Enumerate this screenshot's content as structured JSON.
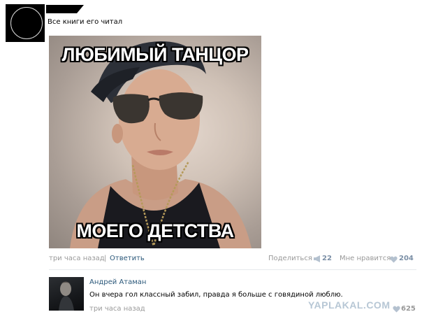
{
  "post": {
    "text": "Все книги его читал",
    "meme": {
      "caption_top": "ЛЮБИМЫЙ ТАНЦОР",
      "caption_bottom": "МОЕГО ДЕТСТВА"
    },
    "time": "три часа назад",
    "separator": "|",
    "reply_label": "Ответить",
    "share_label": "Поделиться",
    "share_icon": "megaphone-icon",
    "share_count": "22",
    "like_label": "Мне нравится",
    "like_icon": "heart-icon",
    "like_count": "204"
  },
  "comment": {
    "author": "Андрей Атаман",
    "text": "Он вчера гол классный забил, правда я больше с говядиной люблю.",
    "time": "три часа назад",
    "like_icon": "heart-icon",
    "like_count": "625"
  },
  "watermark": "YAPLAKAL.COM",
  "colors": {
    "link": "#2b587a",
    "muted": "#999999",
    "count": "#7b8fa6",
    "watermark": "#b7c7d5"
  }
}
